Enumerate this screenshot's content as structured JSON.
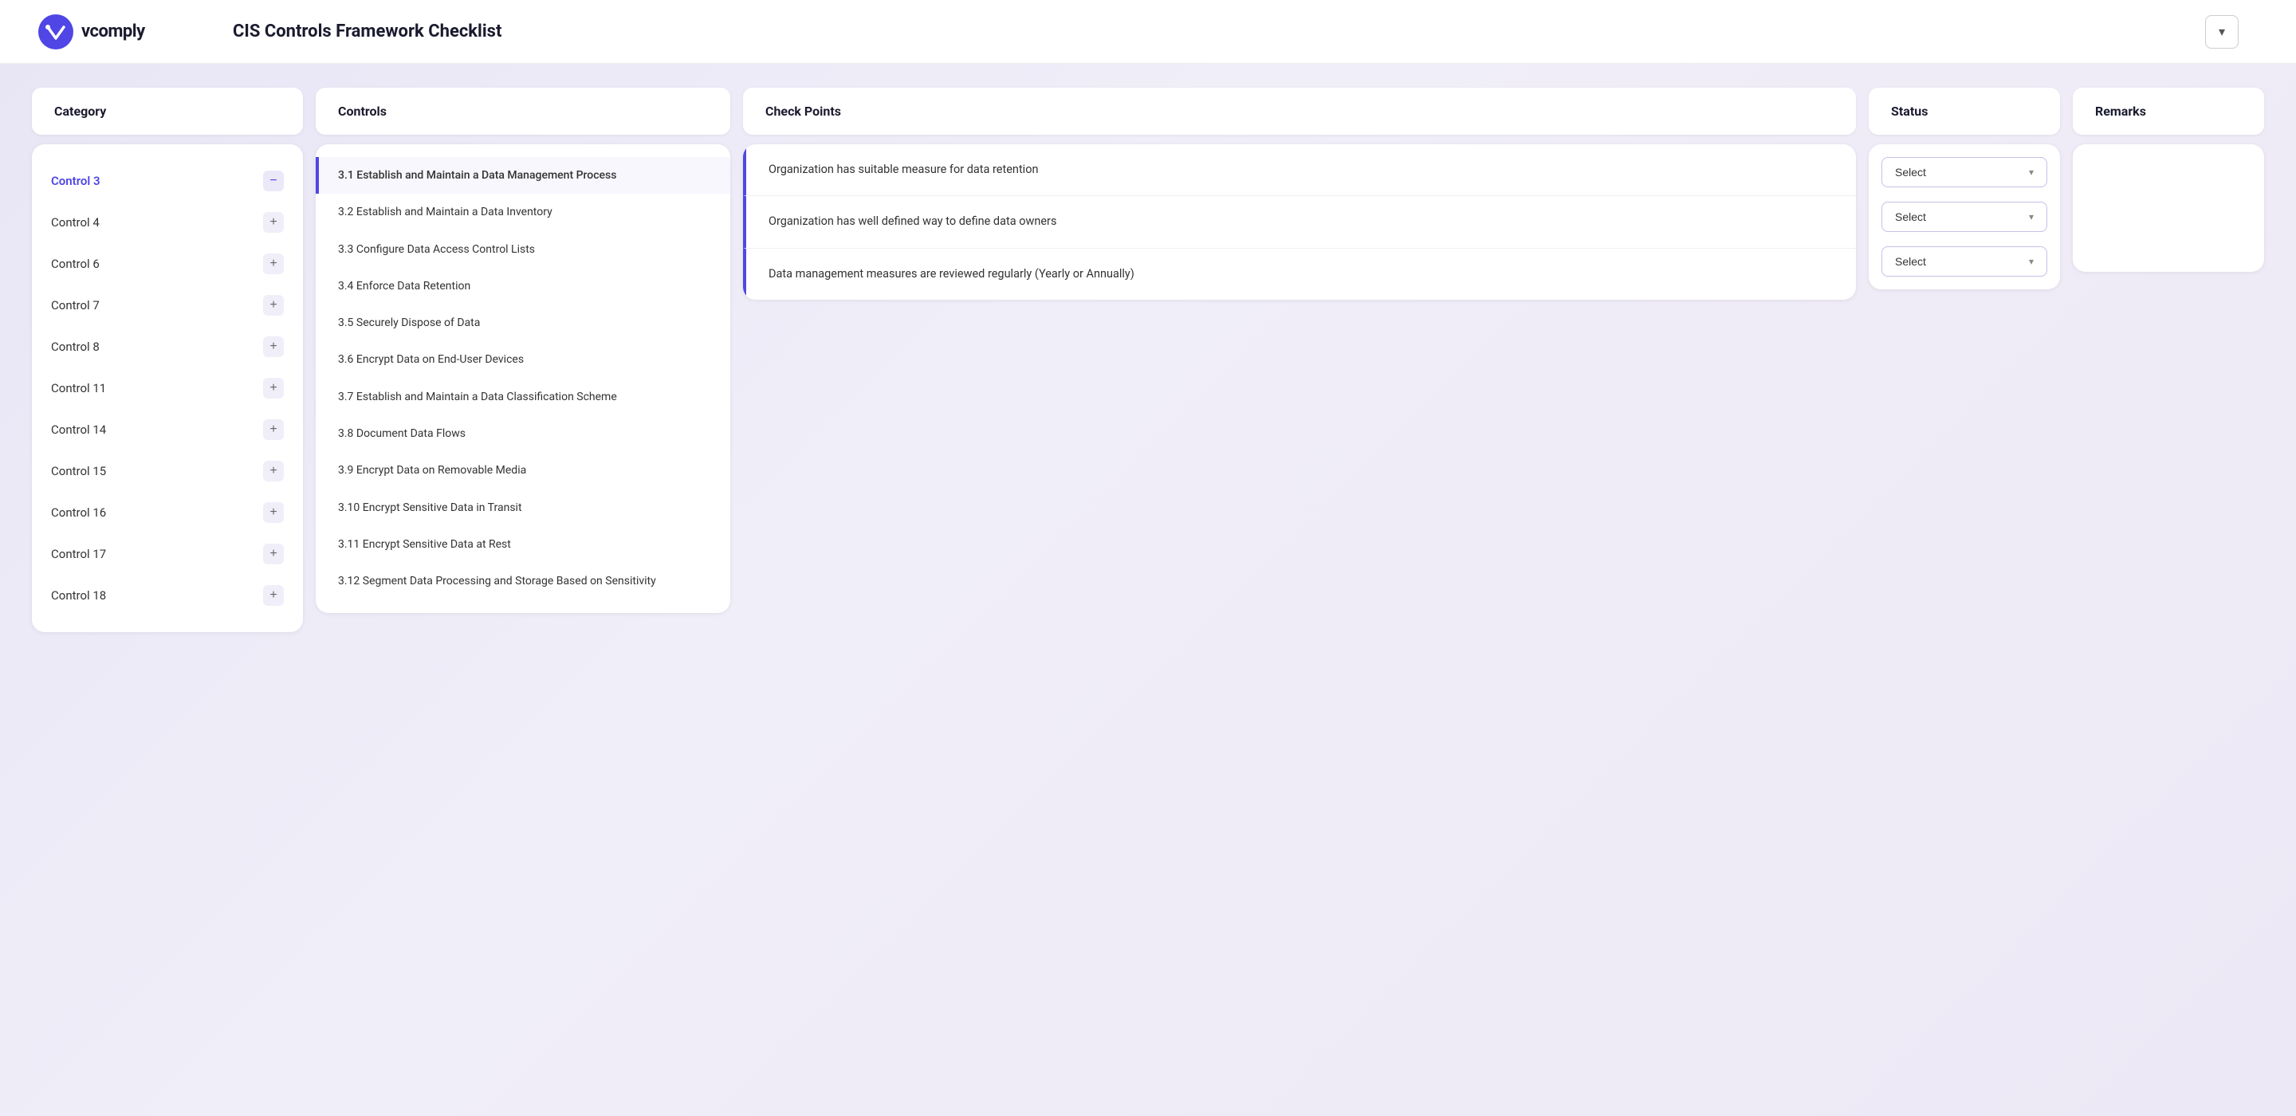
{
  "header": {
    "logo_text": "vcomply",
    "title": "CIS Controls Framework Checklist",
    "chevron": "▾"
  },
  "columns": {
    "category": "Category",
    "controls": "Controls",
    "checkpoints": "Check Points",
    "status": "Status",
    "remarks": "Remarks"
  },
  "categories": [
    {
      "id": "cat-control-3",
      "label": "Control 3",
      "active": true,
      "btn": "−"
    },
    {
      "id": "cat-control-4",
      "label": "Control 4",
      "active": false,
      "btn": "+"
    },
    {
      "id": "cat-control-6",
      "label": "Control 6",
      "active": false,
      "btn": "+"
    },
    {
      "id": "cat-control-7",
      "label": "Control 7",
      "active": false,
      "btn": "+"
    },
    {
      "id": "cat-control-8",
      "label": "Control 8",
      "active": false,
      "btn": "+"
    },
    {
      "id": "cat-control-11",
      "label": "Control 11",
      "active": false,
      "btn": "+"
    },
    {
      "id": "cat-control-14",
      "label": "Control 14",
      "active": false,
      "btn": "+"
    },
    {
      "id": "cat-control-15",
      "label": "Control 15",
      "active": false,
      "btn": "+"
    },
    {
      "id": "cat-control-16",
      "label": "Control 16",
      "active": false,
      "btn": "+"
    },
    {
      "id": "cat-control-17",
      "label": "Control 17",
      "active": false,
      "btn": "+"
    },
    {
      "id": "cat-control-18",
      "label": "Control 18",
      "active": false,
      "btn": "+"
    }
  ],
  "controls": [
    {
      "id": "ctrl-3-1",
      "label": "3.1 Establish and Maintain a Data Management Process",
      "active": true
    },
    {
      "id": "ctrl-3-2",
      "label": "3.2 Establish and Maintain a Data Inventory",
      "active": false
    },
    {
      "id": "ctrl-3-3",
      "label": "3.3 Configure Data Access Control Lists",
      "active": false
    },
    {
      "id": "ctrl-3-4",
      "label": "3.4 Enforce Data Retention",
      "active": false
    },
    {
      "id": "ctrl-3-5",
      "label": "3.5 Securely Dispose of Data",
      "active": false
    },
    {
      "id": "ctrl-3-6",
      "label": "3.6 Encrypt Data on End-User Devices",
      "active": false
    },
    {
      "id": "ctrl-3-7",
      "label": "3.7 Establish and Maintain a Data Classification Scheme",
      "active": false
    },
    {
      "id": "ctrl-3-8",
      "label": "3.8 Document Data Flows",
      "active": false
    },
    {
      "id": "ctrl-3-9",
      "label": "3.9 Encrypt Data on Removable Media",
      "active": false
    },
    {
      "id": "ctrl-3-10",
      "label": "3.10 Encrypt Sensitive Data in Transit",
      "active": false
    },
    {
      "id": "ctrl-3-11",
      "label": "3.11 Encrypt Sensitive Data at Rest",
      "active": false
    },
    {
      "id": "ctrl-3-12",
      "label": "3.12 Segment Data Processing and Storage Based on Sensitivity",
      "active": false
    }
  ],
  "checkpoints": [
    {
      "id": "cp-1",
      "text": "Organization has suitable measure for data retention"
    },
    {
      "id": "cp-2",
      "text": "Organization has well defined way to define data owners"
    },
    {
      "id": "cp-3",
      "text": "Data management measures are reviewed regularly (Yearly or Annually)"
    }
  ],
  "status": {
    "select_label": "Select",
    "selects": [
      {
        "id": "sel-1",
        "value": "Select"
      },
      {
        "id": "sel-2",
        "value": "Select"
      },
      {
        "id": "sel-3",
        "value": "Select"
      }
    ]
  },
  "icons": {
    "chevron_down": "▾",
    "minus": "−",
    "plus": "+"
  }
}
